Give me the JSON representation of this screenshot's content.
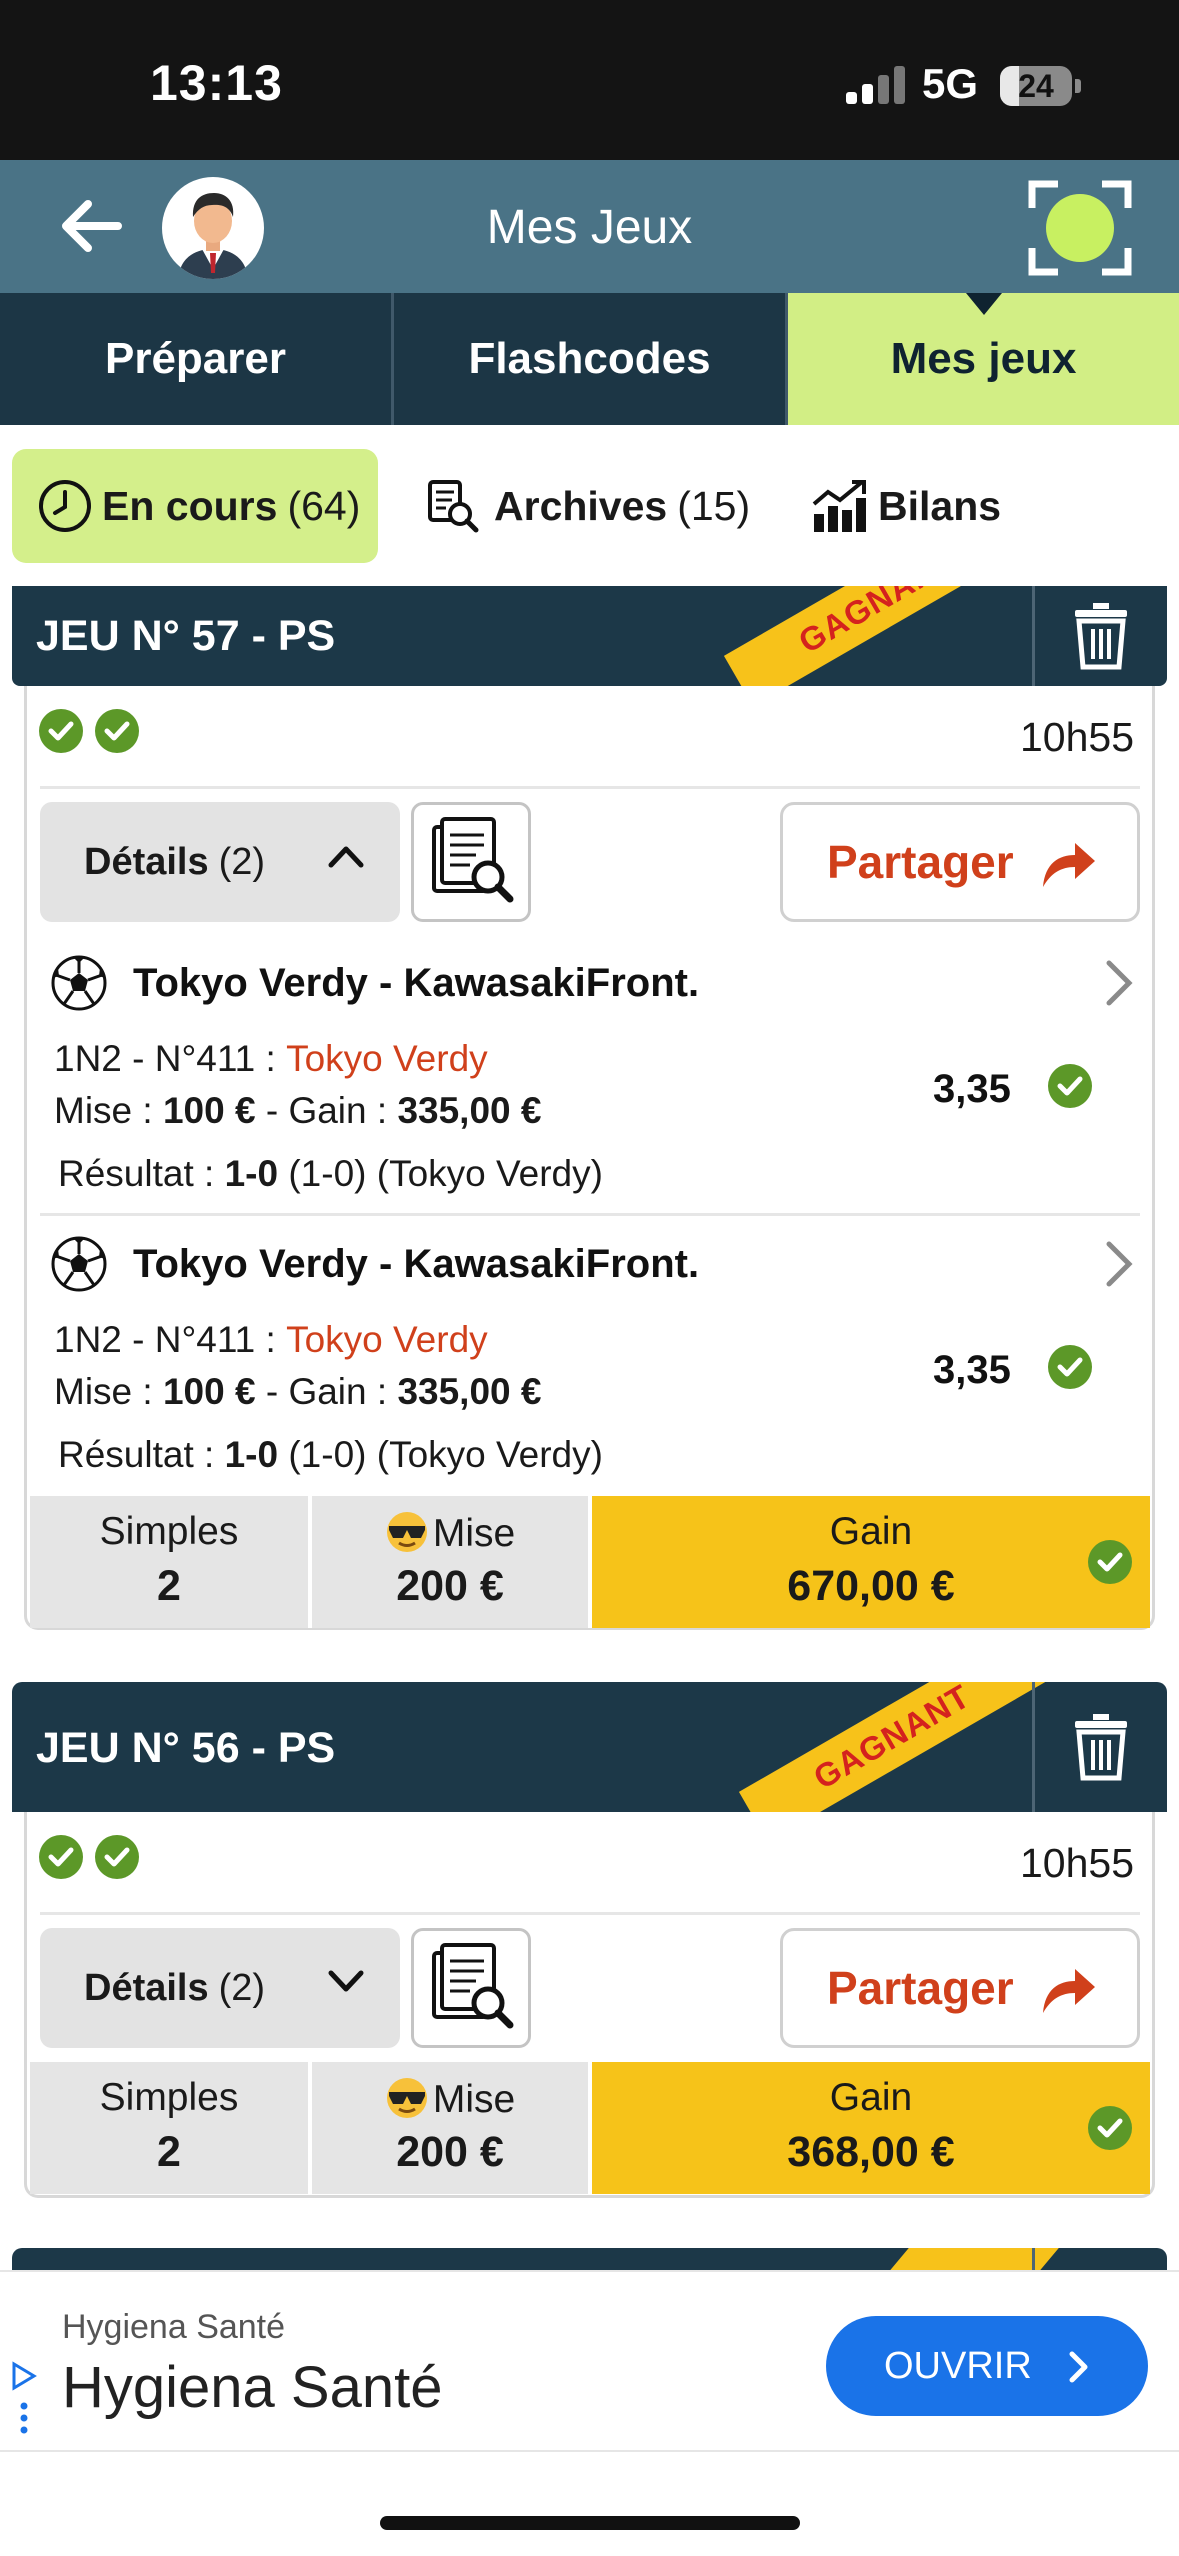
{
  "status_bar": {
    "time": "13:13",
    "network": "5G",
    "battery": "24"
  },
  "header": {
    "title": "Mes Jeux"
  },
  "tabs": [
    {
      "label": "Préparer"
    },
    {
      "label": "Flashcodes"
    },
    {
      "label": "Mes jeux",
      "active": true
    }
  ],
  "subtabs": {
    "en_cours": {
      "label": "En cours",
      "count": "(64)"
    },
    "archives": {
      "label": "Archives",
      "count": "(15)"
    },
    "bilans": {
      "label": "Bilans"
    }
  },
  "games": [
    {
      "title": "JEU N° 57 - PS",
      "ribbon": "GAGNANT",
      "time": "10h55",
      "details_label": "Détails",
      "details_count": "(2)",
      "share_label": "Partager",
      "bets": [
        {
          "match": "Tokyo Verdy - KawasakiFront.",
          "market": "1N2 - N°411 :",
          "pick": "Tokyo Verdy",
          "stake_label": "Mise :",
          "stake": "100 €",
          "gain_label": "- Gain :",
          "gain": "335,00 €",
          "result_label": "Résultat :",
          "result_score": "1-0",
          "result_detail": "(1-0) (Tokyo Verdy)",
          "odds": "3,35"
        },
        {
          "match": "Tokyo Verdy - KawasakiFront.",
          "market": "1N2 - N°411 :",
          "pick": "Tokyo Verdy",
          "stake_label": "Mise :",
          "stake": "100 €",
          "gain_label": "- Gain :",
          "gain": "335,00 €",
          "result_label": "Résultat :",
          "result_score": "1-0",
          "result_detail": "(1-0) (Tokyo Verdy)",
          "odds": "3,35"
        }
      ],
      "summary": {
        "type_label": "Simples",
        "type_value": "2",
        "stake_label": "Mise",
        "stake_value": "200 €",
        "gain_label": "Gain",
        "gain_value": "670,00 €"
      }
    },
    {
      "title": "JEU N° 56 - PS",
      "ribbon": "GAGNANT",
      "time": "10h55",
      "details_label": "Détails",
      "details_count": "(2)",
      "share_label": "Partager",
      "summary": {
        "type_label": "Simples",
        "type_value": "2",
        "stake_label": "Mise",
        "stake_value": "200 €",
        "gain_label": "Gain",
        "gain_value": "368,00 €"
      }
    }
  ],
  "ad": {
    "advertiser": "Hygiena Santé",
    "headline": "Hygiena Santé",
    "cta": "OUVRIR"
  },
  "colors": {
    "header": "#4a7386",
    "tabs_bg": "#1c3645",
    "active_tab": "#d2ee85",
    "gold": "#f6c319",
    "accent_red": "#d0401b",
    "check_green": "#5c9828"
  }
}
